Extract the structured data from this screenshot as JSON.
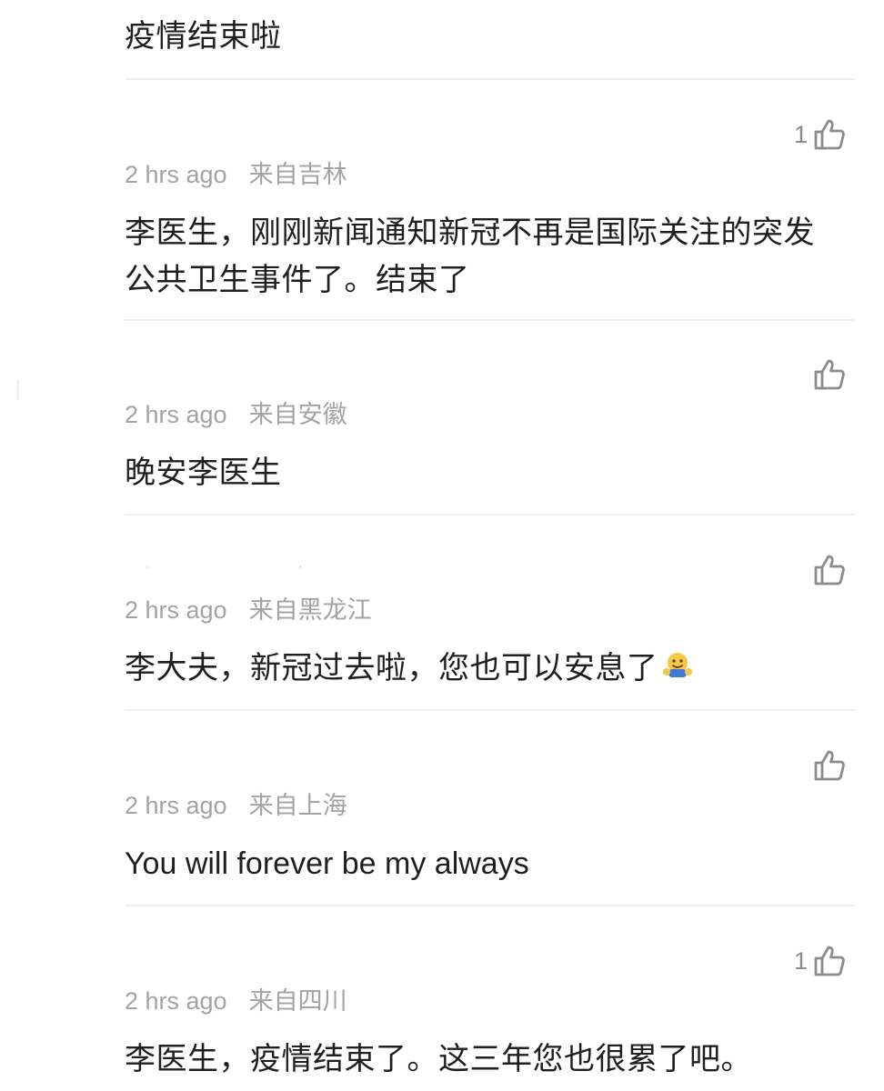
{
  "comments": [
    {
      "text": "疫情结束啦"
    },
    {
      "likes": "1",
      "time": "2 hrs ago",
      "location": "来自吉林",
      "text_line1": "李医生，刚刚新闻通知新冠不再是国际关注的突发",
      "text_line2": "公共卫生事件了。结束了"
    },
    {
      "likes": "",
      "time": "2 hrs ago",
      "location": "来自安徽",
      "text": "晚安李医生"
    },
    {
      "likes": "",
      "time": "2 hrs ago",
      "location": "来自黑龙江",
      "text": "李大夫，新冠过去啦，您也可以安息了",
      "emoji": "hug-emoji"
    },
    {
      "likes": "",
      "time": "2 hrs ago",
      "location": "来自上海",
      "text": "You will forever be my always"
    },
    {
      "likes": "1",
      "time": "2 hrs ago",
      "location": "来自四川",
      "text": "李医生，疫情结束了。这三年您也很累了吧。"
    }
  ],
  "icons": {
    "like": "thumbs-up-outline-icon"
  },
  "colors": {
    "text": "#1f1f1f",
    "meta": "#a3a3a3",
    "divider": "#efefef",
    "icon": "#8c8c8c"
  }
}
